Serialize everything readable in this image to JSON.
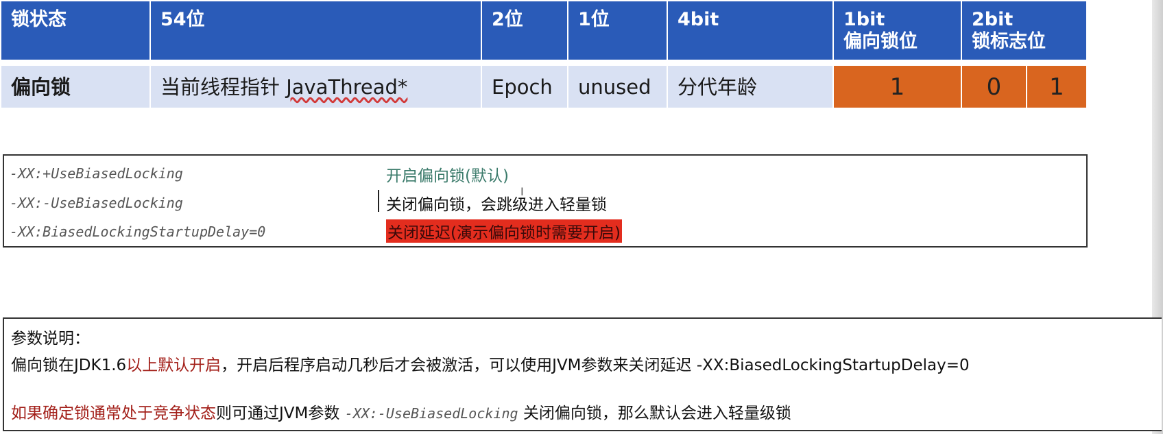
{
  "table": {
    "headers": {
      "lock_state": "锁状态",
      "bits54": "54位",
      "bits2": "2位",
      "bits1": "1位",
      "bits4": "4bit",
      "biased_bit_line1": "1bit",
      "biased_bit_line2": "偏向锁位",
      "flag_bits_line1": "2bit",
      "flag_bits_line2": "锁标志位"
    },
    "row": {
      "state": "偏向锁",
      "thread_pointer_prefix": "当前线程指针 ",
      "thread_pointer_type": "JavaThread*",
      "epoch": "Epoch",
      "unused": "unused",
      "age": "分代年龄",
      "biased_value": "1",
      "flag_value_1": "0",
      "flag_value_2": "1"
    },
    "colors": {
      "header_bg": "#2a5bb8",
      "row_bg": "#d9e1f3",
      "bit_bg": "#d9651f"
    }
  },
  "jvm_params": [
    {
      "flag": "-XX:+UseBiasedLocking",
      "description": "开启偏向锁(默认)"
    },
    {
      "flag": "-XX:-UseBiasedLocking",
      "description": "关闭偏向锁，会跳级进入轻量锁"
    },
    {
      "flag": "-XX:BiasedLockingStartupDelay=0",
      "description": "关闭延迟(演示偏向锁时需要开启)"
    }
  ],
  "explanation": {
    "title": "参数说明：",
    "line1_part1": "偏向锁在JDK1.6",
    "line1_red": "以上默认开启",
    "line1_part2": "，开启后程序启动几秒后才会被激活，可以使用JVM参数来关闭延迟 -XX:BiasedLockingStartupDelay=0",
    "line2_red": "如果确定锁通常处于竞争状态",
    "line2_part1": "则可通过JVM参数 ",
    "line2_flag": "-XX:-UseBiasedLocking",
    "line2_part2": " 关闭偏向锁，那么默认会进入轻量级锁"
  }
}
